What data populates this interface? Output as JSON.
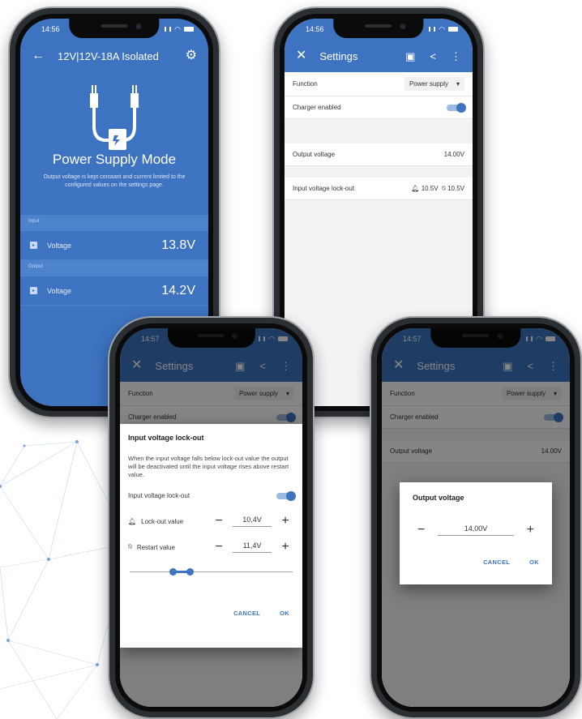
{
  "colors": {
    "brand": "#3d73c0",
    "brand_light": "#4d82cc",
    "dialog_dim": "#000000"
  },
  "phone1": {
    "status_time": "14:56",
    "title": "12V|12V-18A Isolated",
    "back_icon": "arrow-left-icon",
    "settings_icon": "gear-icon",
    "mode_title": "Power Supply Mode",
    "mode_description": "Output voltage is kept constant and current limited to the configured values on the settings page.",
    "sections": [
      {
        "header": "Input",
        "label": "Voltage",
        "value": "13.8V"
      },
      {
        "header": "Output",
        "label": "Voltage",
        "value": "14.2V"
      }
    ]
  },
  "phone2": {
    "status_time": "14:56",
    "title": "Settings",
    "close_icon": "close-icon",
    "save_icon": "save-icon",
    "share_icon": "share-icon",
    "more_icon": "more-vertical-icon",
    "rows": {
      "function_label": "Function",
      "function_value": "Power supply",
      "charger_label": "Charger enabled",
      "charger_on": true,
      "output_label": "Output voltage",
      "output_value": "14.00V",
      "lockout_label": "Input voltage lock-out",
      "lockout_value": "10.5V",
      "restart_value": "10.5V"
    }
  },
  "phone3": {
    "status_time": "14:57",
    "title": "Settings",
    "bg_function_label": "Function",
    "bg_function_value": "Power supply",
    "bg_charger_label": "Charger enabled",
    "dialog": {
      "title": "Input voltage lock-out",
      "text": "When the input voltage falls below lock-out value the output will be deactivated until the input voltage rises above restart value.",
      "toggle_label": "Input voltage lock-out",
      "toggle_on": true,
      "lockout_label": "Lock-out value",
      "lockout_value": "10,4V",
      "restart_label": "Restart value",
      "restart_value": "11,4V",
      "minus": "−",
      "plus": "+",
      "cancel": "CANCEL",
      "ok": "OK"
    }
  },
  "phone4": {
    "status_time": "14:57",
    "title": "Settings",
    "bg_function_label": "Function",
    "bg_function_value": "Power supply",
    "bg_charger_label": "Charger enabled",
    "bg_output_label": "Output voltage",
    "bg_output_value": "14.00V",
    "dialog": {
      "title": "Output voltage",
      "value": "14,00V",
      "minus": "−",
      "plus": "+",
      "cancel": "CANCEL",
      "ok": "OK"
    }
  }
}
